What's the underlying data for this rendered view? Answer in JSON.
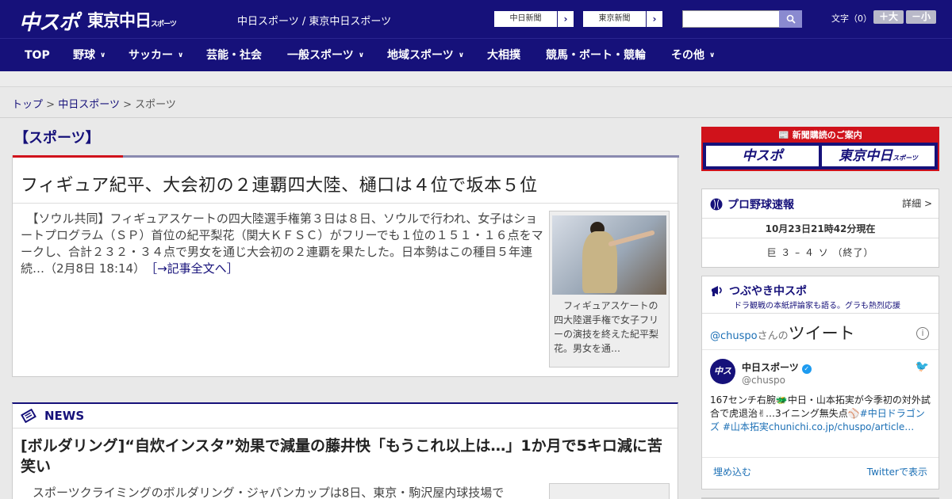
{
  "header": {
    "logo_primary": "中スポ",
    "logo_secondary": "東京中日",
    "logo_secondary_small": "スポーツ",
    "site_name": "中日スポーツ / 東京中日スポーツ",
    "ext_links": [
      {
        "label": "中日新聞",
        "arrow": "›"
      },
      {
        "label": "東京新聞",
        "arrow": "›"
      }
    ],
    "search_placeholder": "",
    "font_size_label": "文字（0）",
    "font_larger": "＋大",
    "font_smaller": "－小"
  },
  "nav": {
    "items": [
      {
        "label": "TOP",
        "has_dropdown": false
      },
      {
        "label": "野球",
        "has_dropdown": true
      },
      {
        "label": "サッカー",
        "has_dropdown": true
      },
      {
        "label": "芸能・社会",
        "has_dropdown": false
      },
      {
        "label": "一般スポーツ",
        "has_dropdown": true
      },
      {
        "label": "地域スポーツ",
        "has_dropdown": true
      },
      {
        "label": "大相撲",
        "has_dropdown": false
      },
      {
        "label": "競馬・ボート・競輪",
        "has_dropdown": false
      },
      {
        "label": "その他",
        "has_dropdown": true
      }
    ],
    "chevron": "∨"
  },
  "breadcrumb": {
    "items": [
      "トップ",
      "中日スポーツ",
      "スポーツ"
    ],
    "separator": ">"
  },
  "main": {
    "section_title": "【スポーツ】",
    "top_article": {
      "headline": "フィギュア紀平、大会初の２連覇四大陸、樋口は４位で坂本５位",
      "body": "　【ソウル共同】フィギュアスケートの四大陸選手権第３日は８日、ソウルで行われ、女子はショートプログラム（ＳＰ）首位の紀平梨花（関大ＫＦＳＣ）がフリーでも１位の１５１・１６点をマークし、合計２３２・３４点で男女を通じ大会初の２連覇を果たした。日本勢はこの種目５年連続…（2月8日 18:14）",
      "more_link": "［→記事全文へ］",
      "caption": "　フィギュアスケートの四大陸選手権で女子フリーの演技を終えた紀平梨花。男女を通…"
    },
    "news": {
      "label": "NEWS",
      "title": "[ボルダリング]“自炊インスタ”効果で減量の藤井快「もうこれ以上は…」1か月で5キロ減に苦笑い",
      "body": "　スポーツクライミングのボルダリング・ジャパンカップは8日、東京・駒沢屋内球技場で"
    }
  },
  "sidebar": {
    "subscription": {
      "title": "新聞購読のご案内",
      "left": "中スポ",
      "right": "東京中日",
      "right_small": "スポーツ"
    },
    "baseball": {
      "title": "プロ野球速報",
      "detail": "詳細 >",
      "time": "10月23日21時42分現在",
      "score": "巨 ３ – ４ ソ （終了）"
    },
    "tweets": {
      "title": "つぶやき中スポ",
      "subtitle": "ドラ観戦の本紙評論家も語る。グラも熱烈応援",
      "handle_prefix": "@chuspo",
      "handle_suffix": "さんの",
      "heading": "ツイート",
      "info": "i",
      "account_name": "中日スポーツ",
      "account_handle": "@chuspo",
      "avatar_text": "中スポ",
      "tweet_text": "167センチ右腕🐲中日・山本拓実が今季初の対外試合で虎退治✌…3イニング無失点⚾",
      "tweet_tags": "#中日ドラゴンズ #山本拓実chunichi.co.jp/chuspo/article…",
      "embed": "埋め込む",
      "view_on_twitter": "Twitterで表示"
    }
  },
  "colors": {
    "brand_navy": "#16117a",
    "accent_red": "#d0121b",
    "link_blue": "#1b6fb5"
  }
}
